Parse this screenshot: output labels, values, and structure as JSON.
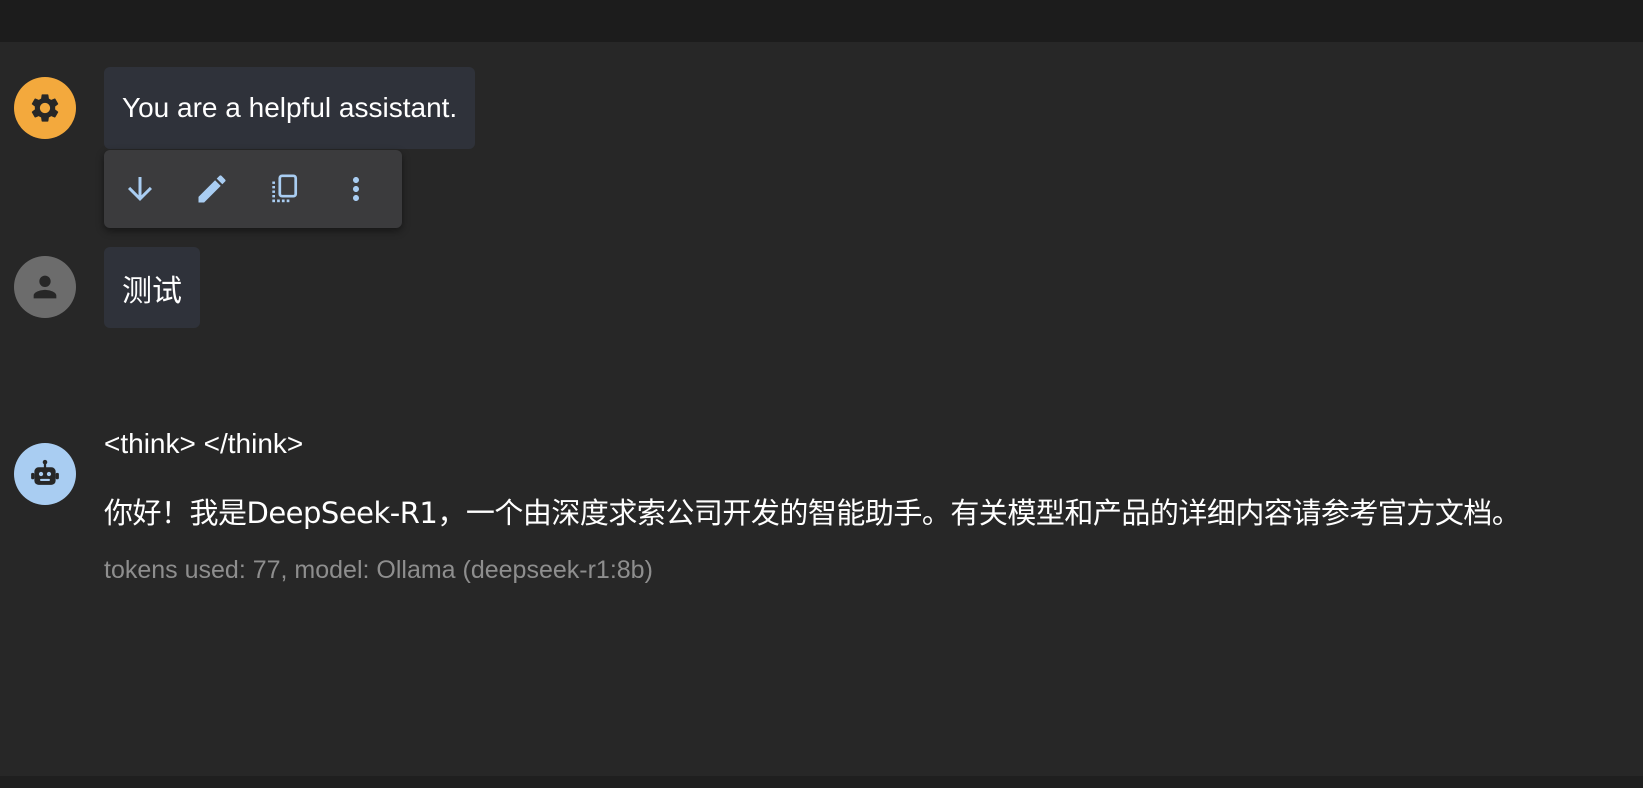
{
  "colors": {
    "background": "#272727",
    "top_bar": "#1c1c1c",
    "bubble": "#2f323a",
    "toolbar": "#3b3b3d",
    "toolbar_icon": "#a9cdf2",
    "system_avatar": "#f3a93d",
    "user_avatar": "#6c6c6c",
    "assistant_avatar": "#a9cdf2",
    "meta_text": "#8e8e8e"
  },
  "messages": {
    "system": {
      "avatar_icon": "gear-icon",
      "text": "You are a helpful assistant."
    },
    "user": {
      "avatar_icon": "person-icon",
      "text": "测试"
    },
    "assistant": {
      "avatar_icon": "robot-icon",
      "think": "<think> </think>",
      "text": "你好！我是DeepSeek-R1，一个由深度求索公司开发的智能助手。有关模型和产品的详细内容请参考官方文档。",
      "meta": "tokens used: 77, model: Ollama (deepseek-r1:8b)"
    }
  },
  "toolbar": {
    "buttons": [
      {
        "icon": "arrow-down-icon"
      },
      {
        "icon": "pencil-icon"
      },
      {
        "icon": "copy-icon"
      },
      {
        "icon": "more-vert-icon"
      }
    ]
  }
}
